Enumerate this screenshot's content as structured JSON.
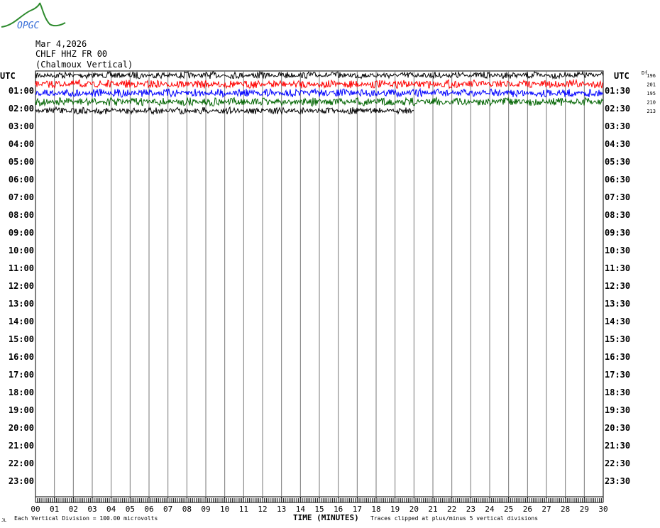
{
  "logo_text": "OPGC",
  "header": {
    "date": "Mar 4,2026",
    "station": "CHLF HHZ FR 00",
    "name": "(Chalmoux Vertical)"
  },
  "left_header": "UTC",
  "right_header": "UTC",
  "offset_header": "Df",
  "footer": {
    "corner": "JL",
    "division": "Each Vertical Division =  100.00 microvolts",
    "xlabel": "TIME (MINUTES)",
    "clip": "Traces clipped at plus/minus 5 vertical divisions"
  },
  "chart_data": {
    "type": "line",
    "title": "Mar 4,2026 CHLF HHZ FR 00 (Chalmoux Vertical)",
    "xlabel": "TIME (MINUTES)",
    "xlim": [
      0,
      30
    ],
    "x_ticks": [
      "00",
      "01",
      "02",
      "03",
      "04",
      "05",
      "06",
      "07",
      "08",
      "09",
      "10",
      "11",
      "12",
      "13",
      "14",
      "15",
      "16",
      "17",
      "18",
      "19",
      "20",
      "21",
      "22",
      "23",
      "24",
      "25",
      "26",
      "27",
      "28",
      "29",
      "30"
    ],
    "left_labels": [
      "",
      "01:00",
      "02:00",
      "03:00",
      "04:00",
      "05:00",
      "06:00",
      "07:00",
      "08:00",
      "09:00",
      "10:00",
      "11:00",
      "12:00",
      "13:00",
      "14:00",
      "15:00",
      "16:00",
      "17:00",
      "18:00",
      "19:00",
      "20:00",
      "21:00",
      "22:00",
      "23:00"
    ],
    "right_labels": [
      "",
      "01:30",
      "02:30",
      "03:30",
      "04:30",
      "05:30",
      "06:30",
      "07:30",
      "08:30",
      "09:30",
      "10:30",
      "11:30",
      "12:30",
      "13:30",
      "14:30",
      "15:30",
      "16:30",
      "17:30",
      "18:30",
      "19:30",
      "20:30",
      "21:30",
      "22:30",
      "23:30"
    ],
    "trace_colors": [
      "#000000",
      "#ff0000",
      "#0000ff",
      "#006400"
    ],
    "traces": [
      {
        "start": "00:00",
        "end_minute": 30,
        "offset": "196"
      },
      {
        "start": "00:30",
        "end_minute": 30,
        "offset": "201"
      },
      {
        "start": "01:00",
        "end_minute": 30,
        "offset": "195"
      },
      {
        "start": "01:30",
        "end_minute": 30,
        "offset": "210"
      },
      {
        "start": "02:00",
        "end_minute": 20,
        "offset": "213"
      }
    ]
  }
}
